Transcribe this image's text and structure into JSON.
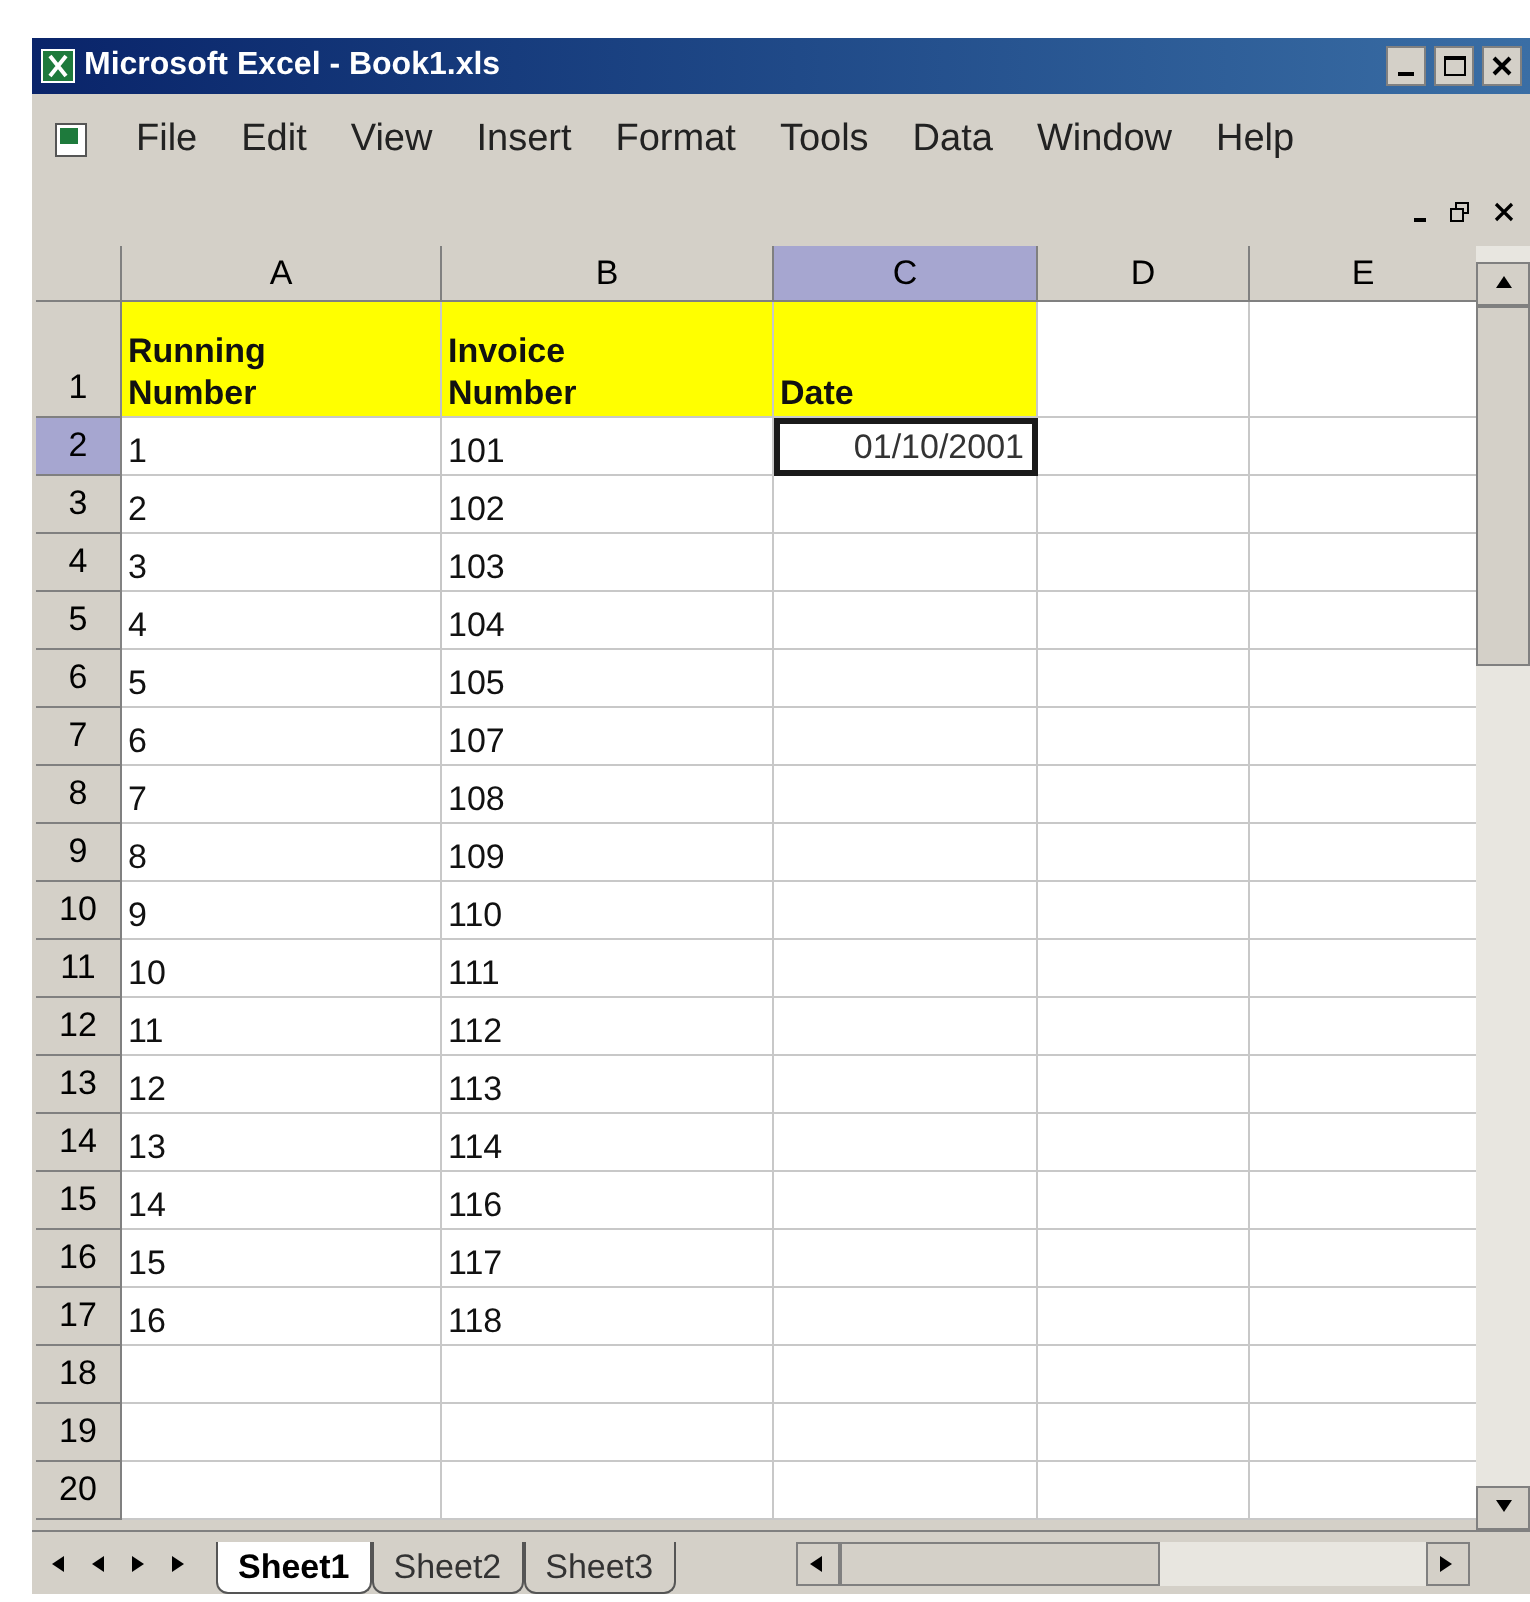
{
  "window": {
    "title": "Microsoft Excel - Book1.xls"
  },
  "menu": [
    "File",
    "Edit",
    "View",
    "Insert",
    "Format",
    "Tools",
    "Data",
    "Window",
    "Help"
  ],
  "columns": [
    {
      "label": "A",
      "selected": false
    },
    {
      "label": "B",
      "selected": false
    },
    {
      "label": "C",
      "selected": true
    },
    {
      "label": "D",
      "selected": false
    },
    {
      "label": "E",
      "selected": false
    }
  ],
  "rows": [
    {
      "number": "1",
      "selected": false,
      "highlight": true,
      "cells": [
        {
          "text": "Running Number",
          "active": false
        },
        {
          "text": "Invoice Number",
          "active": false
        },
        {
          "text": "Date",
          "active": false
        }
      ]
    },
    {
      "number": "2",
      "selected": true,
      "highlight": false,
      "cells": [
        {
          "text": "1",
          "active": false
        },
        {
          "text": "101",
          "active": false
        },
        {
          "text": "01/10/2001",
          "active": true
        }
      ]
    },
    {
      "number": "3",
      "selected": false,
      "highlight": false,
      "cells": [
        {
          "text": "2",
          "active": false
        },
        {
          "text": "102",
          "active": false
        }
      ]
    },
    {
      "number": "4",
      "selected": false,
      "highlight": false,
      "cells": [
        {
          "text": "3",
          "active": false
        },
        {
          "text": "103",
          "active": false
        }
      ]
    },
    {
      "number": "5",
      "selected": false,
      "highlight": false,
      "cells": [
        {
          "text": "4",
          "active": false
        },
        {
          "text": "104",
          "active": false
        }
      ]
    },
    {
      "number": "6",
      "selected": false,
      "highlight": false,
      "cells": [
        {
          "text": "5",
          "active": false
        },
        {
          "text": "105",
          "active": false
        }
      ]
    },
    {
      "number": "7",
      "selected": false,
      "highlight": false,
      "cells": [
        {
          "text": "6",
          "active": false
        },
        {
          "text": "107",
          "active": false
        }
      ]
    },
    {
      "number": "8",
      "selected": false,
      "highlight": false,
      "cells": [
        {
          "text": "7",
          "active": false
        },
        {
          "text": "108",
          "active": false
        }
      ]
    },
    {
      "number": "9",
      "selected": false,
      "highlight": false,
      "cells": [
        {
          "text": "8",
          "active": false
        },
        {
          "text": "109",
          "active": false
        }
      ]
    },
    {
      "number": "10",
      "selected": false,
      "highlight": false,
      "cells": [
        {
          "text": "9",
          "active": false
        },
        {
          "text": "110",
          "active": false
        }
      ]
    },
    {
      "number": "11",
      "selected": false,
      "highlight": false,
      "cells": [
        {
          "text": "10",
          "active": false
        },
        {
          "text": "111",
          "active": false
        }
      ]
    },
    {
      "number": "12",
      "selected": false,
      "highlight": false,
      "cells": [
        {
          "text": "11",
          "active": false
        },
        {
          "text": "112",
          "active": false
        }
      ]
    },
    {
      "number": "13",
      "selected": false,
      "highlight": false,
      "cells": [
        {
          "text": "12",
          "active": false
        },
        {
          "text": "113",
          "active": false
        }
      ]
    },
    {
      "number": "14",
      "selected": false,
      "highlight": false,
      "cells": [
        {
          "text": "13",
          "active": false
        },
        {
          "text": "114",
          "active": false
        }
      ]
    },
    {
      "number": "15",
      "selected": false,
      "highlight": false,
      "cells": [
        {
          "text": "14",
          "active": false
        },
        {
          "text": "116",
          "active": false
        }
      ]
    },
    {
      "number": "16",
      "selected": false,
      "highlight": false,
      "cells": [
        {
          "text": "15",
          "active": false
        },
        {
          "text": "117",
          "active": false
        }
      ]
    },
    {
      "number": "17",
      "selected": false,
      "highlight": false,
      "cells": [
        {
          "text": "16",
          "active": false
        },
        {
          "text": "118",
          "active": false
        }
      ]
    },
    {
      "number": "18",
      "selected": false,
      "highlight": false,
      "cells": []
    },
    {
      "number": "19",
      "selected": false,
      "highlight": false,
      "cells": []
    },
    {
      "number": "20",
      "selected": false,
      "highlight": false,
      "cells": []
    }
  ],
  "sheet_tabs": [
    {
      "label": "Sheet1",
      "selected": true
    },
    {
      "label": "Sheet2",
      "selected": false
    },
    {
      "label": "Sheet3",
      "selected": false
    }
  ]
}
